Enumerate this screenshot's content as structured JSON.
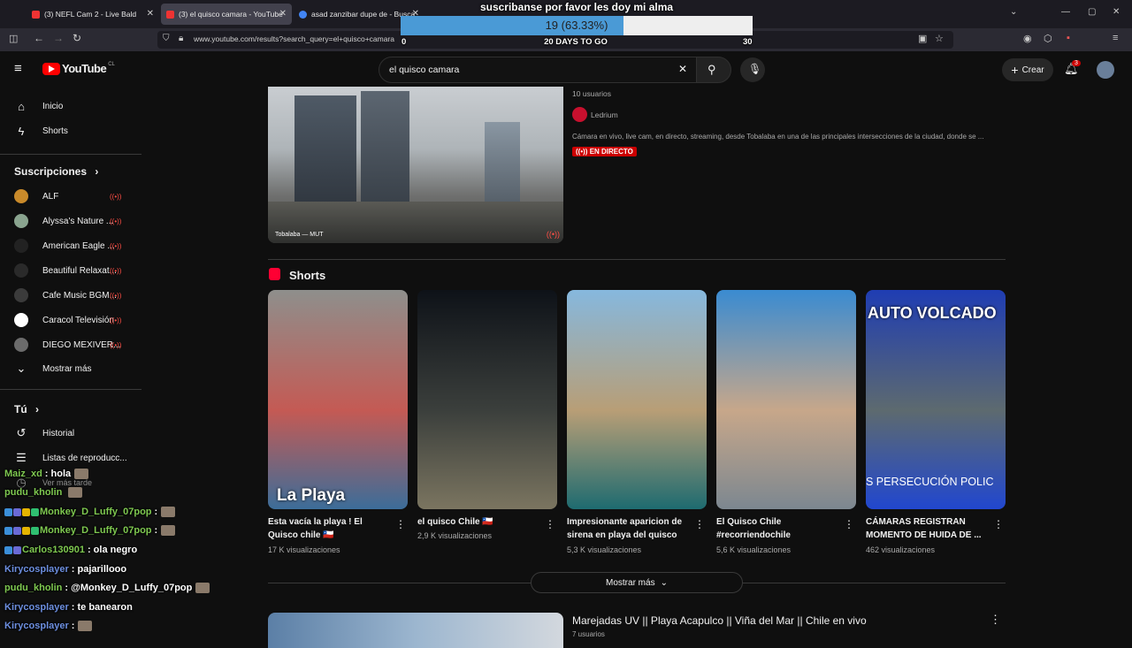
{
  "browser": {
    "tabs": [
      {
        "label": "(3) NEFL Cam 2 - Live Bald"
      },
      {
        "label": "(3) el quisco camara - YouTube"
      },
      {
        "label": "asad zanzibar dupe de - Busca"
      }
    ],
    "url": "www.youtube.com/results?search_query=el+quisco+camara"
  },
  "overlay": {
    "goal_title": "suscribanse por favor les doy mi alma",
    "goal_count": "19 (63.33%)",
    "goal_progress": 0.6333,
    "goal_start": "0",
    "goal_days": "20 DAYS TO GO",
    "goal_end": "30"
  },
  "header": {
    "logo": "YouTube",
    "country": "CL",
    "search_value": "el quisco camara",
    "create_label": "Crear",
    "notif_count": "3"
  },
  "sidebar": {
    "main": [
      {
        "label": "Inicio",
        "icon": "home-icon"
      },
      {
        "label": "Shorts",
        "icon": "shorts-icon"
      }
    ],
    "subs_title": "Suscripciones",
    "subs": [
      {
        "label": "ALF",
        "color": "#c98a2a"
      },
      {
        "label": "Alyssa's Nature ...",
        "color": "#8aa48f"
      },
      {
        "label": "American Eagle ...",
        "color": "#222222"
      },
      {
        "label": "Beautiful Relaxat...",
        "color": "#2a2a2a"
      },
      {
        "label": "Cafe Music BGM...",
        "color": "#3b3b3b"
      },
      {
        "label": "Caracol Televisión",
        "color": "#ffffff"
      },
      {
        "label": "DIEGO MEXIVER...",
        "color": "#6b6b6b"
      }
    ],
    "more_label": "Mostrar más",
    "you_title": "Tú",
    "you": [
      {
        "label": "Historial",
        "icon": "history-icon"
      },
      {
        "label": "Listas de reproducc...",
        "icon": "playlist-icon"
      },
      {
        "label": "Ver más tarde",
        "icon": "watch-later-icon"
      }
    ]
  },
  "top_video": {
    "meta": "10 usuarios",
    "channel": "Ledrium",
    "description": "Cámara en vivo, live cam, en directo, streaming, desde Tobalaba en una de las principales intersecciones de la ciudad, donde se ...",
    "live_badge": "EN DIRECTO",
    "thumb_caption": "Tobalaba — MUT"
  },
  "shorts": {
    "title": "Shorts",
    "items": [
      {
        "title": "Esta vacía la playa ! El Quisco chile 🇨🇱",
        "views": "17 K visualizaciones",
        "overlay_text": "La Playa",
        "colors": [
          "#8e8f8c",
          "#c45a54",
          "#3c6d99"
        ]
      },
      {
        "title": "el quisco Chile 🇨🇱",
        "views": "2,9 K visualizaciones",
        "overlay_text": "",
        "colors": [
          "#0e1218",
          "#3b3f3c",
          "#7b7560"
        ]
      },
      {
        "title": "Impresionante aparicion de sirena en playa del quisco",
        "views": "5,3 K visualizaciones",
        "overlay_text": "",
        "colors": [
          "#86b8de",
          "#b89e76",
          "#1e6b70"
        ]
      },
      {
        "title": "El Quisco Chile #recorriendochile",
        "views": "5,6 K visualizaciones",
        "overlay_text": "",
        "colors": [
          "#3a8bd1",
          "#c7a78a",
          "#7c8790"
        ]
      },
      {
        "title": "CÁMARAS REGISTRAN MOMENTO DE HUIDA DE ...",
        "views": "462 visualizaciones",
        "overlay_text": "AUTO VOLCADO",
        "overlay_bottom": "S PERSECUCIÓN POLIC",
        "colors": [
          "#1f3db3",
          "#5d6a6f",
          "#2147cf"
        ]
      }
    ],
    "more_label": "Mostrar más"
  },
  "next_video": {
    "title": "Marejadas UV || Playa Acapulco || Viña del Mar || Chile en vivo",
    "meta": "7 usuarios"
  },
  "chat": [
    {
      "user": "Maiz_xd",
      "user_color": "#7ec850",
      "msg": ": hola",
      "badges": 0,
      "emote": true
    },
    {
      "user": "pudu_kholin",
      "user_color": "#7ec850",
      "msg": "",
      "badges": 0,
      "emote": true
    },
    {
      "user": "Monkey_D_Luffy_07pop",
      "user_color": "#7ec850",
      "msg": ":",
      "badges": 4,
      "emote": true
    },
    {
      "user": "Monkey_D_Luffy_07pop",
      "user_color": "#7ec850",
      "msg": ":",
      "badges": 4,
      "emote": true
    },
    {
      "user": "Carlos130901",
      "user_color": "#7ec850",
      "msg": ": ola negro",
      "badges": 2,
      "emote": false
    },
    {
      "user": "Kirycosplayer",
      "user_color": "#6d8fe0",
      "msg": ": pajarillooo",
      "badges": 0,
      "emote": false
    },
    {
      "user": "pudu_kholin",
      "user_color": "#7ec850",
      "msg": ": @Monkey_D_Luffy_07pop",
      "badges": 0,
      "emote": true
    },
    {
      "user": "Kirycosplayer",
      "user_color": "#6d8fe0",
      "msg": ": te banearon",
      "badges": 0,
      "emote": false
    },
    {
      "user": "Kirycosplayer",
      "user_color": "#6d8fe0",
      "msg": ":",
      "badges": 0,
      "emote": true
    }
  ]
}
